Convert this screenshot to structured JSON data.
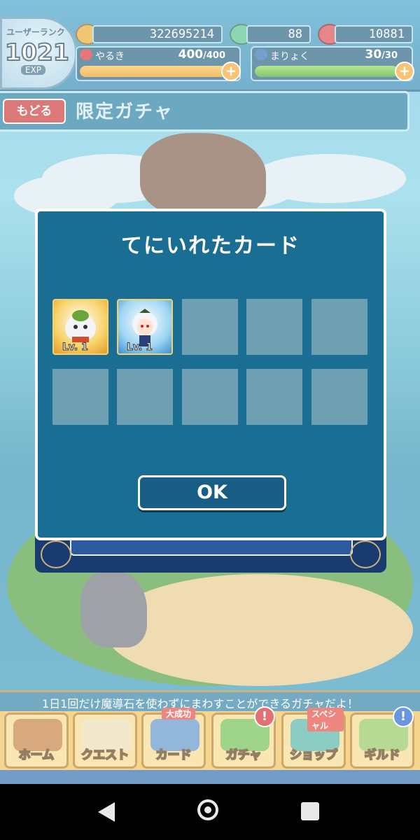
{
  "header": {
    "rank_label": "ユーザーランク",
    "rank_value": "1021",
    "exp_label": "EXP",
    "coins": "322695214",
    "magic_stones": "88",
    "meat": "10881",
    "yaruki": {
      "label": "やるき",
      "value": "400",
      "max": "/400",
      "fill": 1.0
    },
    "maryoku": {
      "label": "まりょく",
      "value": "30",
      "max": "/30",
      "fill": 1.0
    },
    "plus_symbol": "+"
  },
  "title_bar": {
    "back_label": "もどる",
    "title": "限定ガチャ"
  },
  "modal": {
    "title": "てにいれたカード",
    "cards": [
      {
        "level": "Lv. 1",
        "icon": "white-elephant-character-icon"
      },
      {
        "level": "Lv. 1",
        "icon": "white-haired-girl-character-icon"
      }
    ],
    "empty_slots": 8,
    "ok_label": "OK"
  },
  "ticker": {
    "text": "1日1回だけ魔導石を使わずにまわすことができるガチャだよ！"
  },
  "menu": {
    "items": [
      {
        "label": "ホーム",
        "icon": "house-icon"
      },
      {
        "label": "クエスト",
        "icon": "map-icon"
      },
      {
        "label": "カード",
        "icon": "card-icon",
        "ribbon": "大成功"
      },
      {
        "label": "ガチャ",
        "icon": "gacha-icon",
        "badge": "!"
      },
      {
        "label": "ショップ",
        "icon": "shop-icon",
        "ribbon": "スペシャル"
      },
      {
        "label": "ギルド",
        "icon": "guild-icon",
        "badge": "!"
      }
    ]
  },
  "colors": {
    "accent": "#1a6e93",
    "back_button": "#c9302f",
    "yaruki_bar": "#f5a623",
    "maryoku_bar": "#5ab92b"
  }
}
